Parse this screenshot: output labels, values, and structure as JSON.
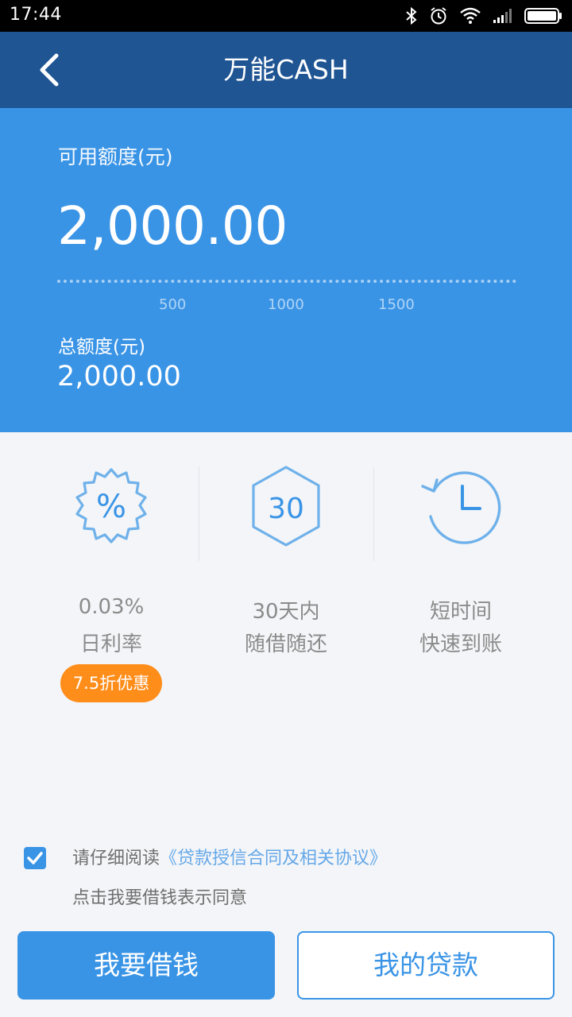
{
  "status_bar": {
    "time": "17:44",
    "icons": [
      "bluetooth-icon",
      "alarm-icon",
      "wifi-icon",
      "signal-icon",
      "battery-icon"
    ]
  },
  "header": {
    "title": "万能CASH",
    "back_icon": "chevron-left-icon"
  },
  "credit": {
    "available_label": "可用额度(元)",
    "available_amount": "2,000.00",
    "slider_ticks": [
      "500",
      "1000",
      "1500"
    ],
    "total_label": "总额度(元)",
    "total_amount": "2,000.00"
  },
  "features": [
    {
      "icon": "percent-badge-icon",
      "line1": "0.03%",
      "line2": "日利率",
      "badge": "7.5折优惠"
    },
    {
      "icon": "hexagon-30-icon",
      "icon_text": "30",
      "line1": "30天内",
      "line2": "随借随还"
    },
    {
      "icon": "clock-history-icon",
      "line1": "短时间",
      "line2": "快速到账"
    }
  ],
  "agreement": {
    "checked": true,
    "prefix": "请仔细阅读",
    "link": "《贷款授信合同及相关协议》",
    "note": "点击我要借钱表示同意"
  },
  "actions": {
    "borrow_label": "我要借钱",
    "my_loans_label": "我的贷款"
  },
  "colors": {
    "nav": "#1f5593",
    "primary": "#3a94e6",
    "badge": "#ff8d1a",
    "icon_stroke": "#6fb1ea"
  }
}
